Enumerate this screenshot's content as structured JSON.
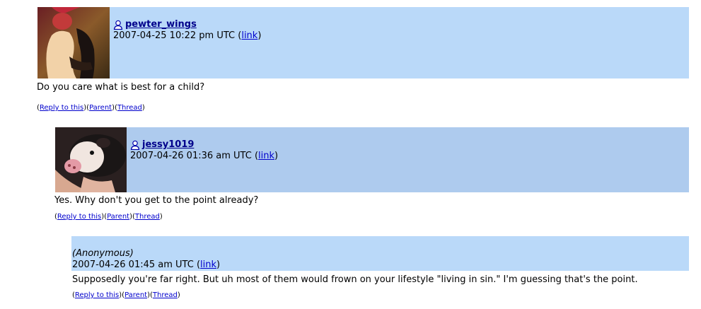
{
  "comments": [
    {
      "username": "pewter_wings",
      "timestamp": "2007-04-25 10:22 pm UTC",
      "link_label": "link",
      "body": "Do you care what is best for a child?",
      "actions": {
        "reply": "Reply to this",
        "parent": "Parent",
        "thread": "Thread"
      },
      "avatar": "user-avatar-figure"
    },
    {
      "username": "jessy1019",
      "timestamp": "2007-04-26 01:36 am UTC",
      "link_label": "link",
      "body": "Yes. Why don't you get to the point already?",
      "actions": {
        "reply": "Reply to this",
        "parent": "Parent",
        "thread": "Thread"
      },
      "avatar": "user-avatar-piglet"
    },
    {
      "username": "(Anonymous)",
      "timestamp": "2007-04-26 01:45 am UTC",
      "link_label": "link",
      "body": "Supposedly you're far right. But uh most of them would frown on your lifestyle \"living in sin.\" I'm guessing that's the point.",
      "actions": {
        "reply": "Reply to this",
        "parent": "Parent",
        "thread": "Thread"
      }
    }
  ],
  "colors": {
    "header_bg": "#bad9f9",
    "header_bg_alt": "#aecbee",
    "link": "#0000cc",
    "username": "#00008b"
  }
}
